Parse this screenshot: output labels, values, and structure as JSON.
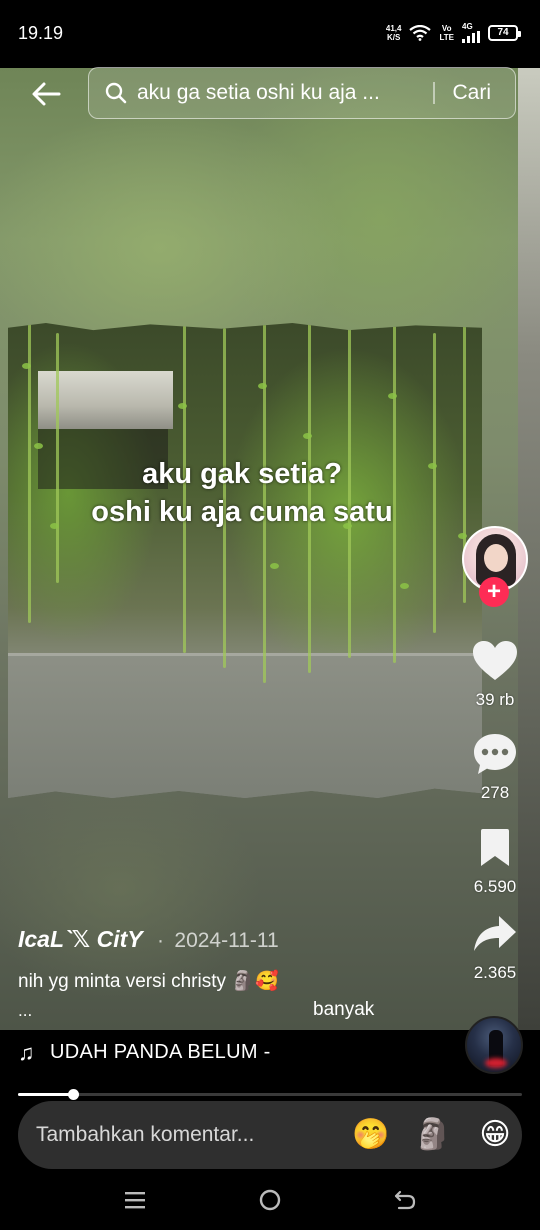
{
  "status_bar": {
    "time": "19.19",
    "net_speed_value": "41,4",
    "net_speed_unit": "K/S",
    "volte_top": "Vo",
    "volte_bottom": "LTE",
    "network_type": "4G",
    "battery": "74"
  },
  "search": {
    "query": "aku ga setia oshi ku aja ...",
    "button_label": "Cari"
  },
  "video": {
    "overlay_lines": [
      "aku gak setia?",
      "oshi ku aja cuma satu"
    ]
  },
  "actions": {
    "likes": "39 rb",
    "comments": "278",
    "bookmarks": "6.590",
    "shares": "2.365"
  },
  "post": {
    "author": "IcaL`𝕏 CitY",
    "date_separator": "·",
    "date": "2024-11-11",
    "caption": "nih yg minta versi christy 🗿🥰",
    "caption_more": "...",
    "side_note": "banyak"
  },
  "music": {
    "note_icon": "♫",
    "title": "UDAH PANDA BELUM -"
  },
  "progress": {
    "fraction": 0.11
  },
  "comment": {
    "placeholder": "Tambahkan komentar...",
    "emojis": [
      "🤭",
      "🗿",
      "😁"
    ]
  },
  "colors": {
    "follow_accent": "#fe2c55",
    "background": "#000000",
    "comment_box": "#2f2f2f"
  },
  "icons": {
    "back": "back-arrow-icon",
    "search": "search-icon",
    "like": "heart-icon",
    "comment": "comment-bubble-icon",
    "bookmark": "bookmark-icon",
    "share": "share-arrow-icon",
    "nav_recent": "recent-apps-icon",
    "nav_home": "home-circle-icon",
    "nav_back": "back-return-icon"
  }
}
